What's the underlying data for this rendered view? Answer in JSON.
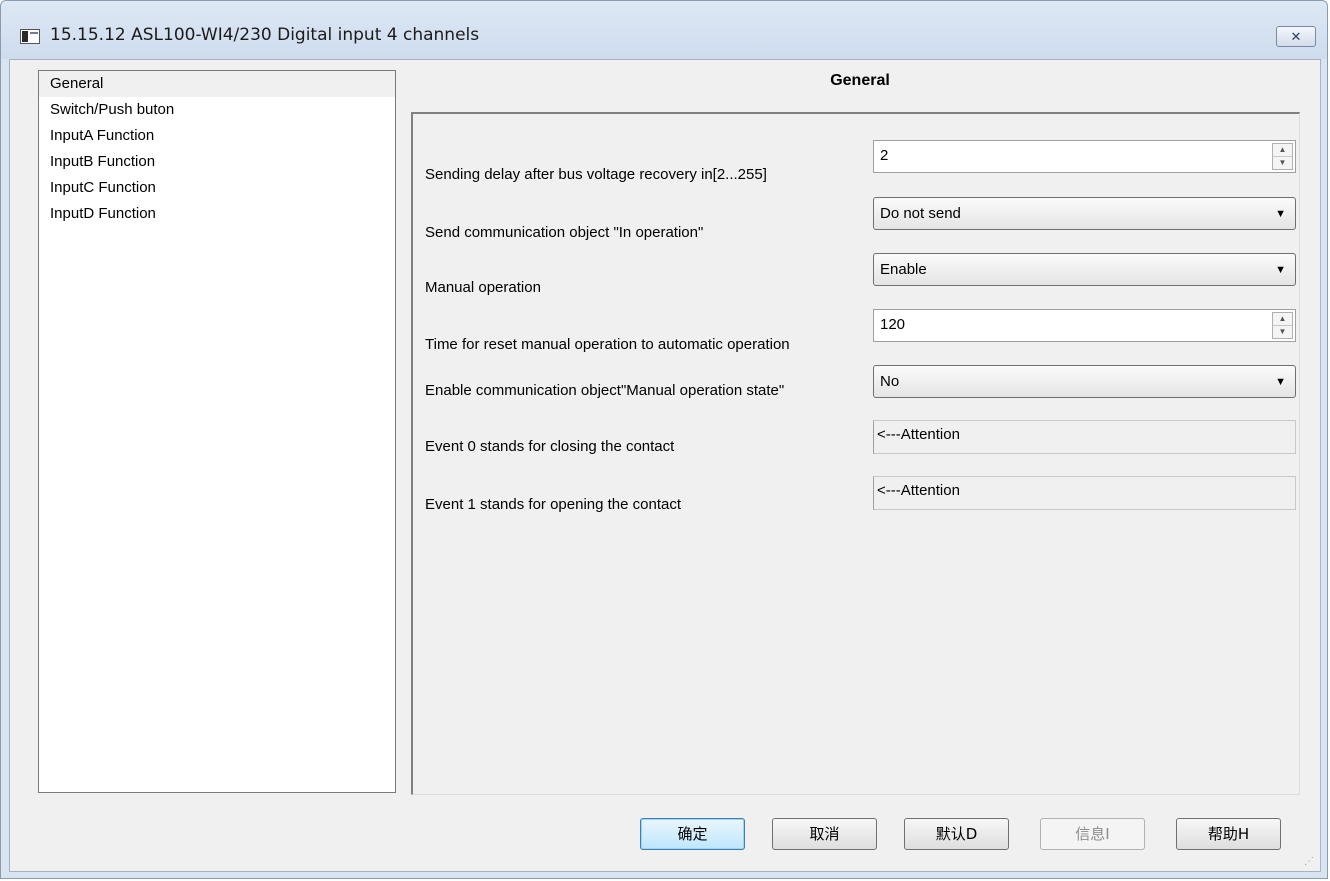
{
  "window": {
    "title": "15.15.12 ASL100-WI4/230 Digital input 4 channels",
    "close_glyph": "✕"
  },
  "sidebar": {
    "items": [
      {
        "label": "General",
        "selected": true
      },
      {
        "label": "Switch/Push buton",
        "selected": false
      },
      {
        "label": "InputA Function",
        "selected": false
      },
      {
        "label": "InputB Function",
        "selected": false
      },
      {
        "label": "InputC Function",
        "selected": false
      },
      {
        "label": "InputD Function",
        "selected": false
      }
    ]
  },
  "page": {
    "title": "General",
    "rows": [
      {
        "label": "Sending delay after bus voltage recovery in[2...255]",
        "type": "spinner",
        "value": "2"
      },
      {
        "label": "Send communication object \"In operation\"",
        "type": "select",
        "value": "Do not send"
      },
      {
        "label": "Manual operation",
        "type": "select",
        "value": "Enable"
      },
      {
        "label": "Time for reset manual operation to automatic operation",
        "type": "spinner",
        "value": "120"
      },
      {
        "label": "Enable communication object\"Manual operation state\"",
        "type": "select",
        "value": "No"
      },
      {
        "label": "Event 0 stands for closing the contact",
        "type": "readonly",
        "value": "<---Attention"
      },
      {
        "label": "Event 1 stands for opening the contact",
        "type": "readonly",
        "value": "<---Attention"
      }
    ]
  },
  "buttons": {
    "ok": "确定",
    "cancel": "取消",
    "default": "默认D",
    "info": "信息I",
    "help": "帮助H"
  }
}
